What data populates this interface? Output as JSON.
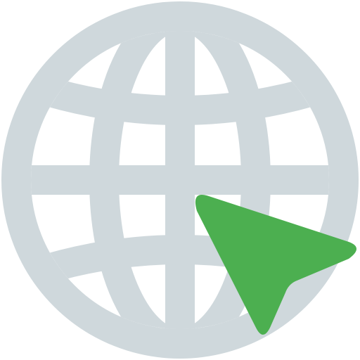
{
  "icon": {
    "name": "globe-with-cursor-icon",
    "parts": [
      "globe-icon",
      "cursor-arrow-icon"
    ]
  },
  "colors": {
    "background": "#ffffff",
    "globe": "#CFD8DC",
    "cursor": "#4CAF50"
  }
}
